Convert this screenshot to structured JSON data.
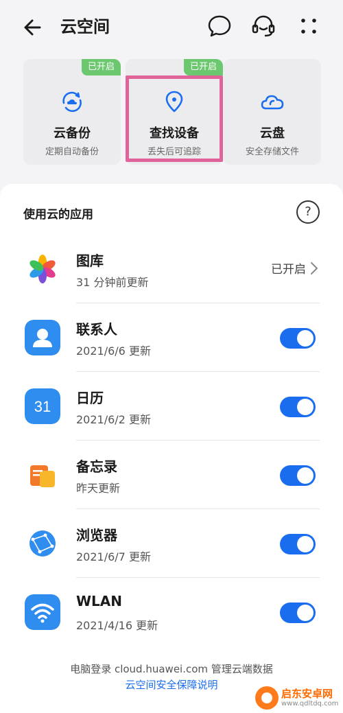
{
  "header": {
    "title": "云空间"
  },
  "cards": [
    {
      "title": "云备份",
      "subtitle": "定期自动备份",
      "badge": "已开启"
    },
    {
      "title": "查找设备",
      "subtitle": "丢失后可追踪",
      "badge": "已开启"
    },
    {
      "title": "云盘",
      "subtitle": "安全存储文件"
    }
  ],
  "apps_section": {
    "title": "使用云的应用",
    "items": [
      {
        "name": "图库",
        "sub": "31 分钟前更新",
        "status": "已开启"
      },
      {
        "name": "联系人",
        "sub": "2021/6/6 更新",
        "enabled": true
      },
      {
        "name": "日历",
        "sub": "2021/6/2 更新",
        "icon_text": "31",
        "enabled": true
      },
      {
        "name": "备忘录",
        "sub": "昨天更新",
        "enabled": true
      },
      {
        "name": "浏览器",
        "sub": "2021/6/7 更新",
        "enabled": true
      },
      {
        "name": "WLAN",
        "sub": "2021/4/16 更新",
        "enabled": true
      }
    ]
  },
  "footer": {
    "line1": "电脑登录 cloud.huawei.com 管理云端数据",
    "link": "云空间安全保障说明"
  },
  "watermark": {
    "name": "启东安卓网",
    "url": "www.qdltdq.com"
  },
  "colors": {
    "accent": "#1b6df0",
    "badge": "#6bc86f",
    "highlight": "#e0649a"
  }
}
